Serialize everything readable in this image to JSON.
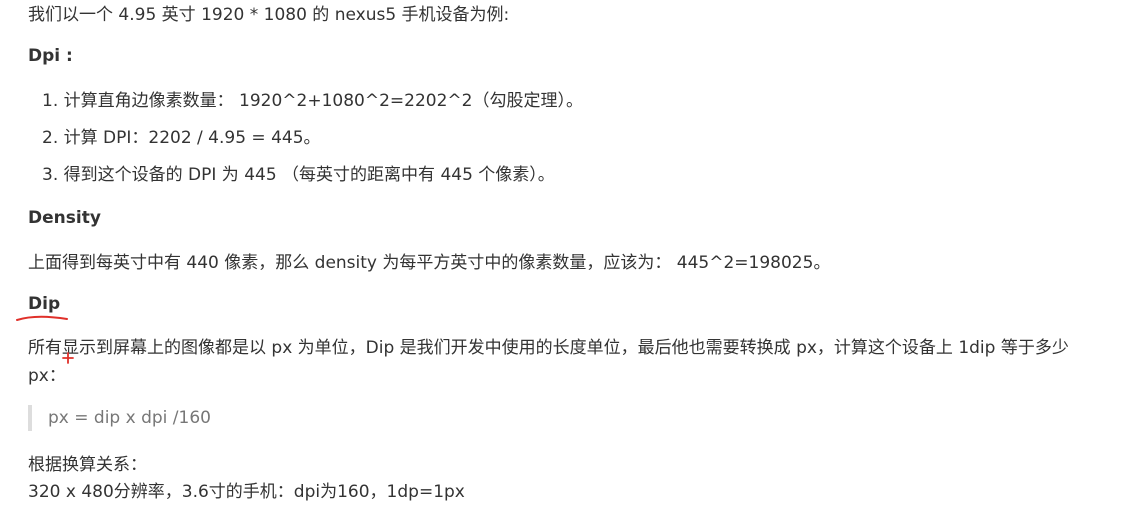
{
  "intro": "我们以一个 4.95 英寸 1920 * 1080 的 nexus5 手机设备为例:",
  "dpi": {
    "heading": "Dpi :",
    "items": [
      "1. 计算直角边像素数量： 1920^2+1080^2=2202^2（勾股定理）。",
      "2. 计算 DPI：2202 / 4.95 = 445。",
      "3. 得到这个设备的 DPI 为 445 （每英寸的距离中有 445 个像素）。"
    ]
  },
  "density": {
    "heading": "Density",
    "text": "上面得到每英寸中有 440 像素，那么 density 为每平方英寸中的像素数量，应该为： 445^2=198025。"
  },
  "dip": {
    "heading": "Dip",
    "text": "所有显示到屏幕上的图像都是以 px 为单位，Dip 是我们开发中使用的长度单位，最后他也需要转换成 px，计算这个设备上 1dip 等于多少 px：",
    "formula": "px = dip x dpi /160"
  },
  "conversion": {
    "heading": "根据换算关系：",
    "line": "320 x 480分辨率，3.6寸的手机：dpi为160，1dp=1px"
  },
  "annotation_color": "#e0302a"
}
